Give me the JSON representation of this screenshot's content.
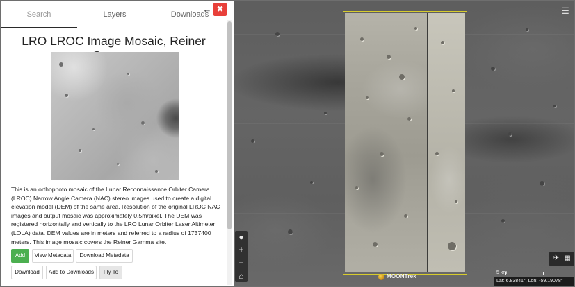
{
  "tabs": [
    {
      "label": "Search",
      "active": true
    },
    {
      "label": "Layers",
      "active": false
    },
    {
      "label": "Downloads",
      "active": false
    }
  ],
  "panel_controls": {
    "back_icon": "arrow-left-icon",
    "close_icon": "close-icon"
  },
  "product": {
    "title": "LRO LROC Image Mosaic, Reiner Gamma",
    "description": "This is an orthophoto mosaic of the Lunar Reconnaissance Orbiter Camera (LROC) Narrow Angle Camera (NAC) stereo images used to create a digital elevation model (DEM) of the same area. Resolution of the original LROC NAC images and output mosaic was approximately 0.5m/pixel. The DEM was registered horizontally and vertically to the LRO Lunar Orbiter Laser Altimeter (LOLA) data. DEM values are in meters and referred to a radius of 1737400 meters. This image mosaic covers the Reiner Gamma site."
  },
  "actions": {
    "add": "Add",
    "view_metadata": "View Metadata",
    "download_metadata": "Download Metadata",
    "download": "Download",
    "add_to_downloads": "Add to Downloads",
    "fly_to": "Fly To"
  },
  "map": {
    "menu_icon": "hamburger-menu-icon",
    "zoom_controls": [
      "globe-icon",
      "plus-icon",
      "minus-icon",
      "home-icon"
    ],
    "tools": [
      "airplane-icon",
      "map-icon"
    ],
    "scale_label": "5 km",
    "coordinates": "Lat: 6.83841°, Lon: -59.19078°",
    "brand": "MOONTrek"
  },
  "colors": {
    "add_button": "#4caf50",
    "close_button": "#e8403a",
    "mosaic_outline": "#d7cc2c"
  }
}
